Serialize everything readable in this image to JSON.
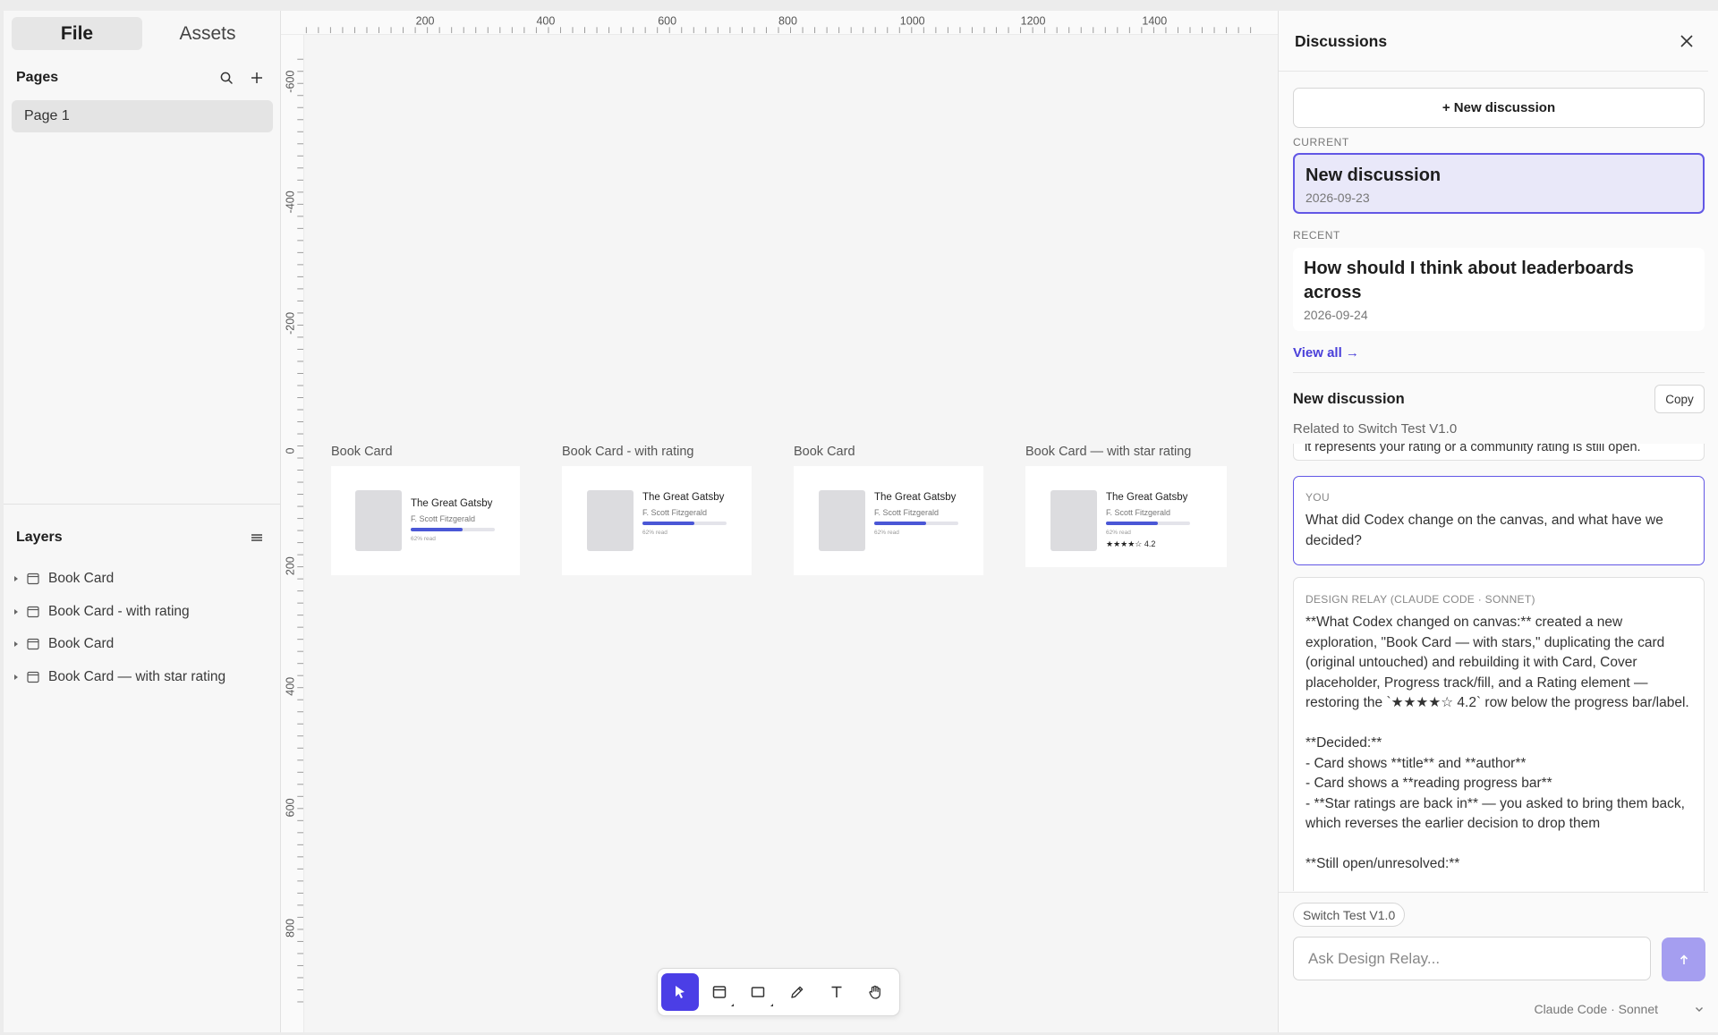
{
  "sidebar": {
    "tabs": [
      {
        "label": "File",
        "active": true
      },
      {
        "label": "Assets",
        "active": false
      }
    ],
    "pages_title": "Pages",
    "pages": [
      {
        "label": "Page 1",
        "selected": true
      }
    ],
    "layers_title": "Layers",
    "layers": [
      {
        "label": "Book Card"
      },
      {
        "label": "Book Card - with rating"
      },
      {
        "label": "Book Card"
      },
      {
        "label": "Book Card — with star rating"
      }
    ]
  },
  "canvas": {
    "ruler_top": [
      "200",
      "400",
      "600",
      "800",
      "1000",
      "1200",
      "1400"
    ],
    "ruler_left": [
      "-600",
      "-400",
      "-200",
      "0",
      "200",
      "400",
      "600",
      "800"
    ],
    "frames": [
      {
        "label": "Book Card",
        "title": "The Great Gatsby",
        "author": "F. Scott Fitzgerald",
        "progress": 0.62,
        "progress_text": "62% read",
        "rating": ""
      },
      {
        "label": "Book Card - with rating",
        "title": "The Great Gatsby",
        "author": "F. Scott Fitzgerald",
        "progress": 0.62,
        "progress_text": "62% read",
        "rating": ""
      },
      {
        "label": "Book Card",
        "title": "The Great Gatsby",
        "author": "F. Scott Fitzgerald",
        "progress": 0.62,
        "progress_text": "62% read",
        "rating": ""
      },
      {
        "label": "Book Card — with star rating",
        "title": "The Great Gatsby",
        "author": "F. Scott Fitzgerald",
        "progress": 0.62,
        "progress_text": "62% read",
        "rating": "★★★★☆ 4.2"
      }
    ],
    "toolbar": {
      "tools": [
        {
          "name": "move-tool",
          "icon": "cursor-arrow-icon",
          "active": true
        },
        {
          "name": "frame-tool",
          "icon": "frame-icon",
          "active": false
        },
        {
          "name": "rectangle-tool",
          "icon": "rectangle-icon",
          "active": false
        },
        {
          "name": "pen-tool",
          "icon": "pencil-icon",
          "active": false
        },
        {
          "name": "text-tool",
          "icon": "text-icon",
          "active": false
        },
        {
          "name": "hand-tool",
          "icon": "hand-icon",
          "active": false
        }
      ]
    }
  },
  "discussions": {
    "title": "Discussions",
    "new_button": "+ New discussion",
    "current_label": "CURRENT",
    "current": {
      "title": "New discussion",
      "date": "2026-09-23"
    },
    "recent_label": "RECENT",
    "recent": [
      {
        "title": "How should I think about leaderboards across",
        "date": "2026-09-24"
      }
    ],
    "view_all": "View all →",
    "active": {
      "title": "New discussion",
      "copy_label": "Copy",
      "related": "Related to Switch Test V1.0",
      "messages": [
        {
          "author": "",
          "text": "it represents your rating or a community rating is still open."
        },
        {
          "author": "YOU",
          "text": "What did Codex change on the canvas, and what have we decided?"
        },
        {
          "author": "DESIGN RELAY (CLAUDE CODE · SONNET)",
          "text": "**What Codex changed on canvas:** created a new exploration, \"Book Card — with stars,\" duplicating the card (original untouched) and rebuilding it with Card, Cover placeholder, Progress track/fill, and a Rating element — restoring the `★★★★☆ 4.2` row below the progress bar/label.\n\n**Decided:**\n- Card shows **title** and **author**\n- Card shows a **reading progress bar**\n- **Star ratings are back in** — you asked to bring them back, which reverses the earlier decision to drop them\n\n**Still open/unresolved:**"
        }
      ]
    },
    "context_chip": "Switch Test V1.0",
    "input": {
      "placeholder": "Ask Design Relay...",
      "value": ""
    },
    "model": "Claude Code · Sonnet",
    "accent": "#4b3ee6"
  }
}
